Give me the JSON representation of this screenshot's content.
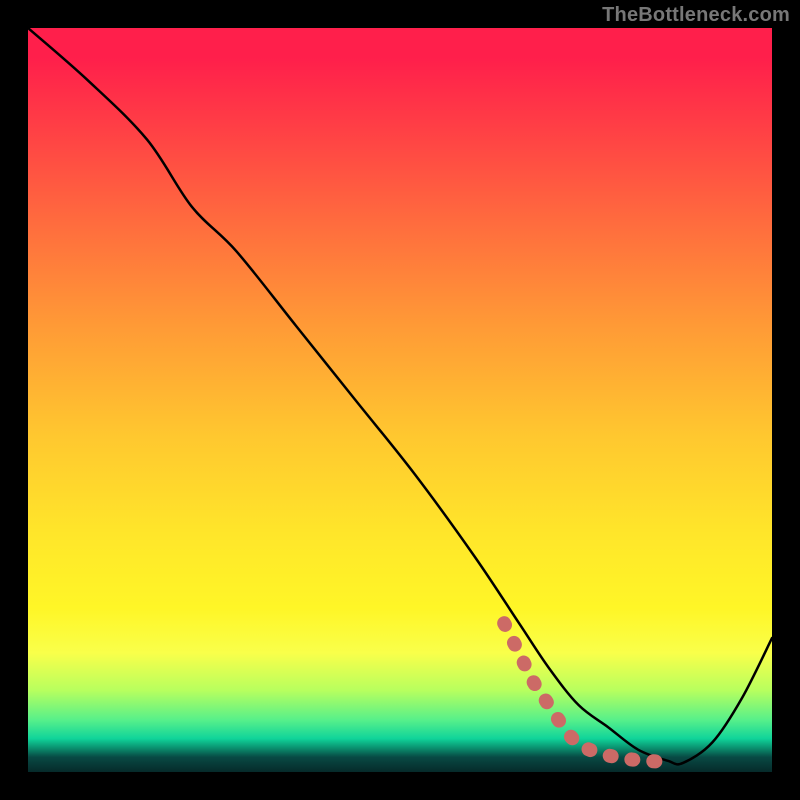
{
  "attribution": "TheBottleneck.com",
  "chart_data": {
    "type": "line",
    "title": "",
    "xlabel": "",
    "ylabel": "",
    "xlim": [
      0,
      100
    ],
    "ylim": [
      0,
      100
    ],
    "series": [
      {
        "name": "curve",
        "color": "#000000",
        "x": [
          0,
          8,
          16,
          22,
          28,
          36,
          44,
          52,
          60,
          66,
          70,
          74,
          78,
          82,
          86,
          88,
          92,
          96,
          100
        ],
        "y": [
          100,
          93,
          85,
          76,
          70,
          60,
          50,
          40,
          29,
          20,
          14,
          9,
          6,
          3,
          1.5,
          1.2,
          4,
          10,
          18
        ]
      },
      {
        "name": "highlight",
        "color": "#cc6a66",
        "style": "thick-dotted",
        "x": [
          64,
          66,
          68,
          70,
          72,
          73.5,
          75,
          77,
          79,
          81,
          83,
          85
        ],
        "y": [
          20,
          16,
          12,
          9,
          6,
          4.2,
          3.2,
          2.5,
          2.0,
          1.7,
          1.5,
          1.4
        ]
      }
    ]
  }
}
